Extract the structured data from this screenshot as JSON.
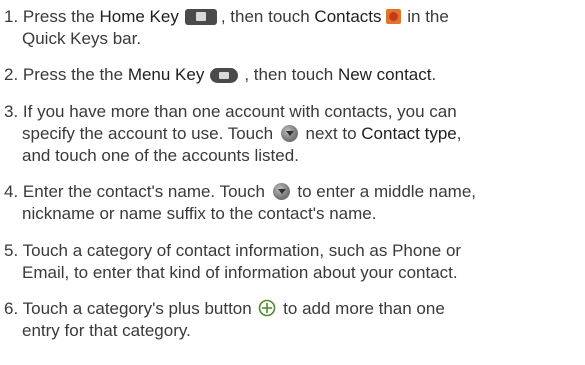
{
  "steps": [
    {
      "number": "1.",
      "text_a": "Press the ",
      "home_key_label": "Home Key",
      "text_b": ", then touch ",
      "contacts_label": "Contacts",
      "text_c": " in the",
      "line2": "Quick Keys bar.",
      "icons": [
        "home-key-icon",
        "contacts-app-icon"
      ]
    },
    {
      "number": "2.",
      "text_a": "Press the the ",
      "menu_key_label": "Menu Key",
      "text_b": ", then touch ",
      "new_contact_label": "New contact",
      "text_c": ".",
      "icons": [
        "menu-key-icon"
      ]
    },
    {
      "number": "3.",
      "line1": "If you have more than one account with contacts, you can",
      "line2_a": "specify the account to use. Touch ",
      "line2_b": " next to ",
      "contact_type_label": "Contact type",
      "line2_c": ",",
      "line3": "and touch one of the accounts listed.",
      "icons": [
        "dropdown-arrow-icon"
      ]
    },
    {
      "number": "4.",
      "line1_a": "Enter the contact's name. Touch ",
      "line1_b": " to enter a middle name,",
      "line2": "nickname or name suffix to the contact's name.",
      "icons": [
        "dropdown-arrow-icon"
      ]
    },
    {
      "number": "5.",
      "line1": "Touch a category of contact information, such as Phone or",
      "line2": "Email, to enter that kind of information about your contact."
    },
    {
      "number": "6.",
      "line1_a": "Touch a category's plus button ",
      "line1_b": " to add more than one",
      "line2": "entry for that category.",
      "icons": [
        "plus-circle-icon"
      ]
    }
  ],
  "colors": {
    "text": "#3a3a3a",
    "key_icon": "#4a4a4a",
    "contacts_icon": "#e2742a",
    "plus_icon": "#4f8a2e"
  }
}
